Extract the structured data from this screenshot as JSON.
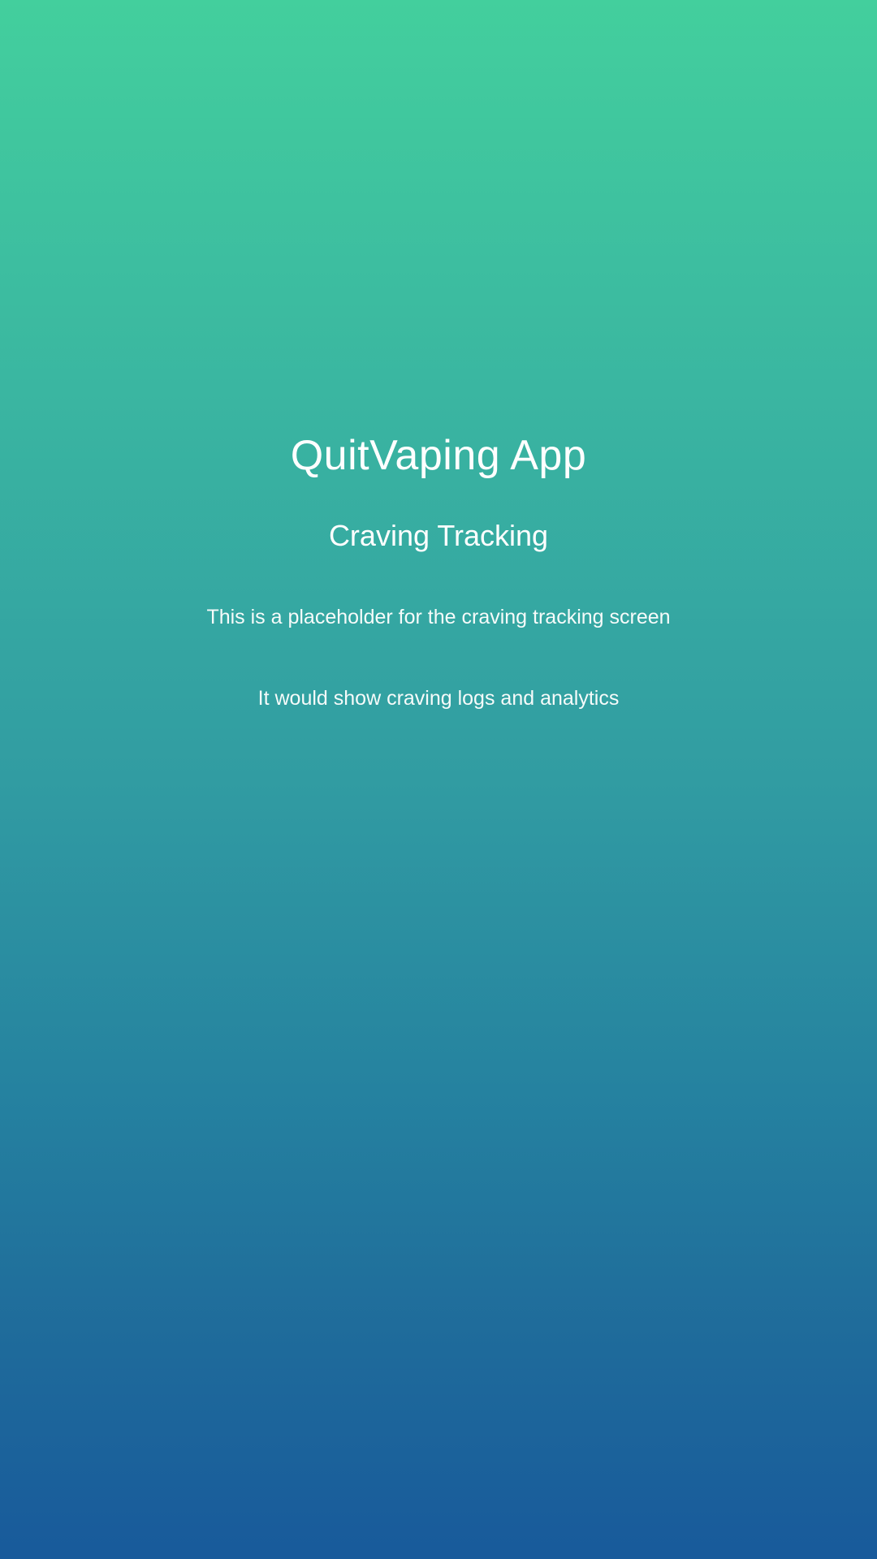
{
  "app": {
    "title": "QuitVaping App"
  },
  "screen": {
    "title": "Craving Tracking",
    "description_line1": "This is a placeholder for the craving tracking screen",
    "description_line2": "It would show craving logs and analytics"
  },
  "colors": {
    "gradient_top": "#43cf9d",
    "gradient_bottom": "#185a9b",
    "text": "#ffffff"
  }
}
